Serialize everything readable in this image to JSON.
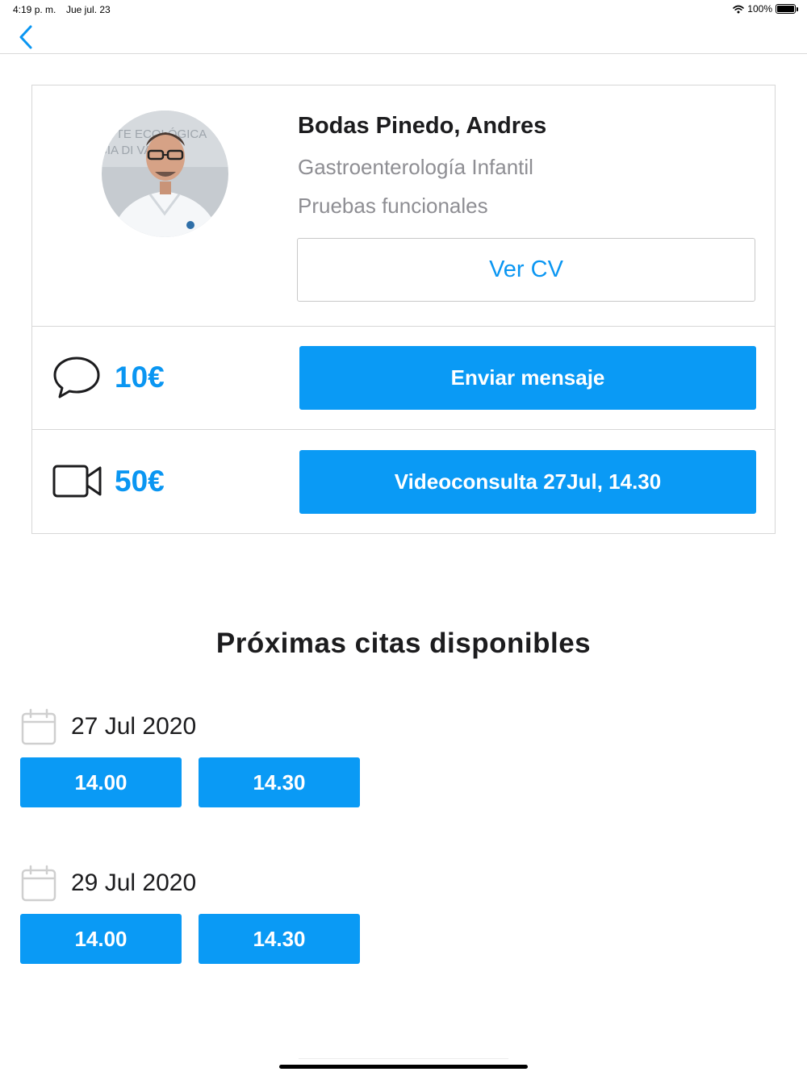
{
  "status_bar": {
    "time": "4:19 p. m.",
    "date": "Jue jul. 23",
    "battery": "100%",
    "battery_level": 1.0
  },
  "nav": {
    "back_icon": "chevron-left-icon"
  },
  "doctor": {
    "name": "Bodas Pinedo, Andres",
    "specialty": "Gastroenterología Infantil",
    "subspecialty": "Pruebas funcionales",
    "cv_label": "Ver CV"
  },
  "services": [
    {
      "icon": "chat-bubble-icon",
      "price": "10€",
      "button_label": "Enviar mensaje"
    },
    {
      "icon": "video-camera-icon",
      "price": "50€",
      "button_label": "Videoconsulta 27Jul, 14.30"
    }
  ],
  "appointments": {
    "title": "Próximas citas disponibles",
    "dates": [
      {
        "label": "27 Jul 2020",
        "slots": [
          "14.00",
          "14.30"
        ]
      },
      {
        "label": "29 Jul 2020",
        "slots": [
          "14.00",
          "14.30"
        ]
      }
    ]
  },
  "colors": {
    "accent": "#0A96F2",
    "button": "#0A9AF5",
    "border": "#D7D7D7",
    "muted_text": "#8E8E93"
  }
}
